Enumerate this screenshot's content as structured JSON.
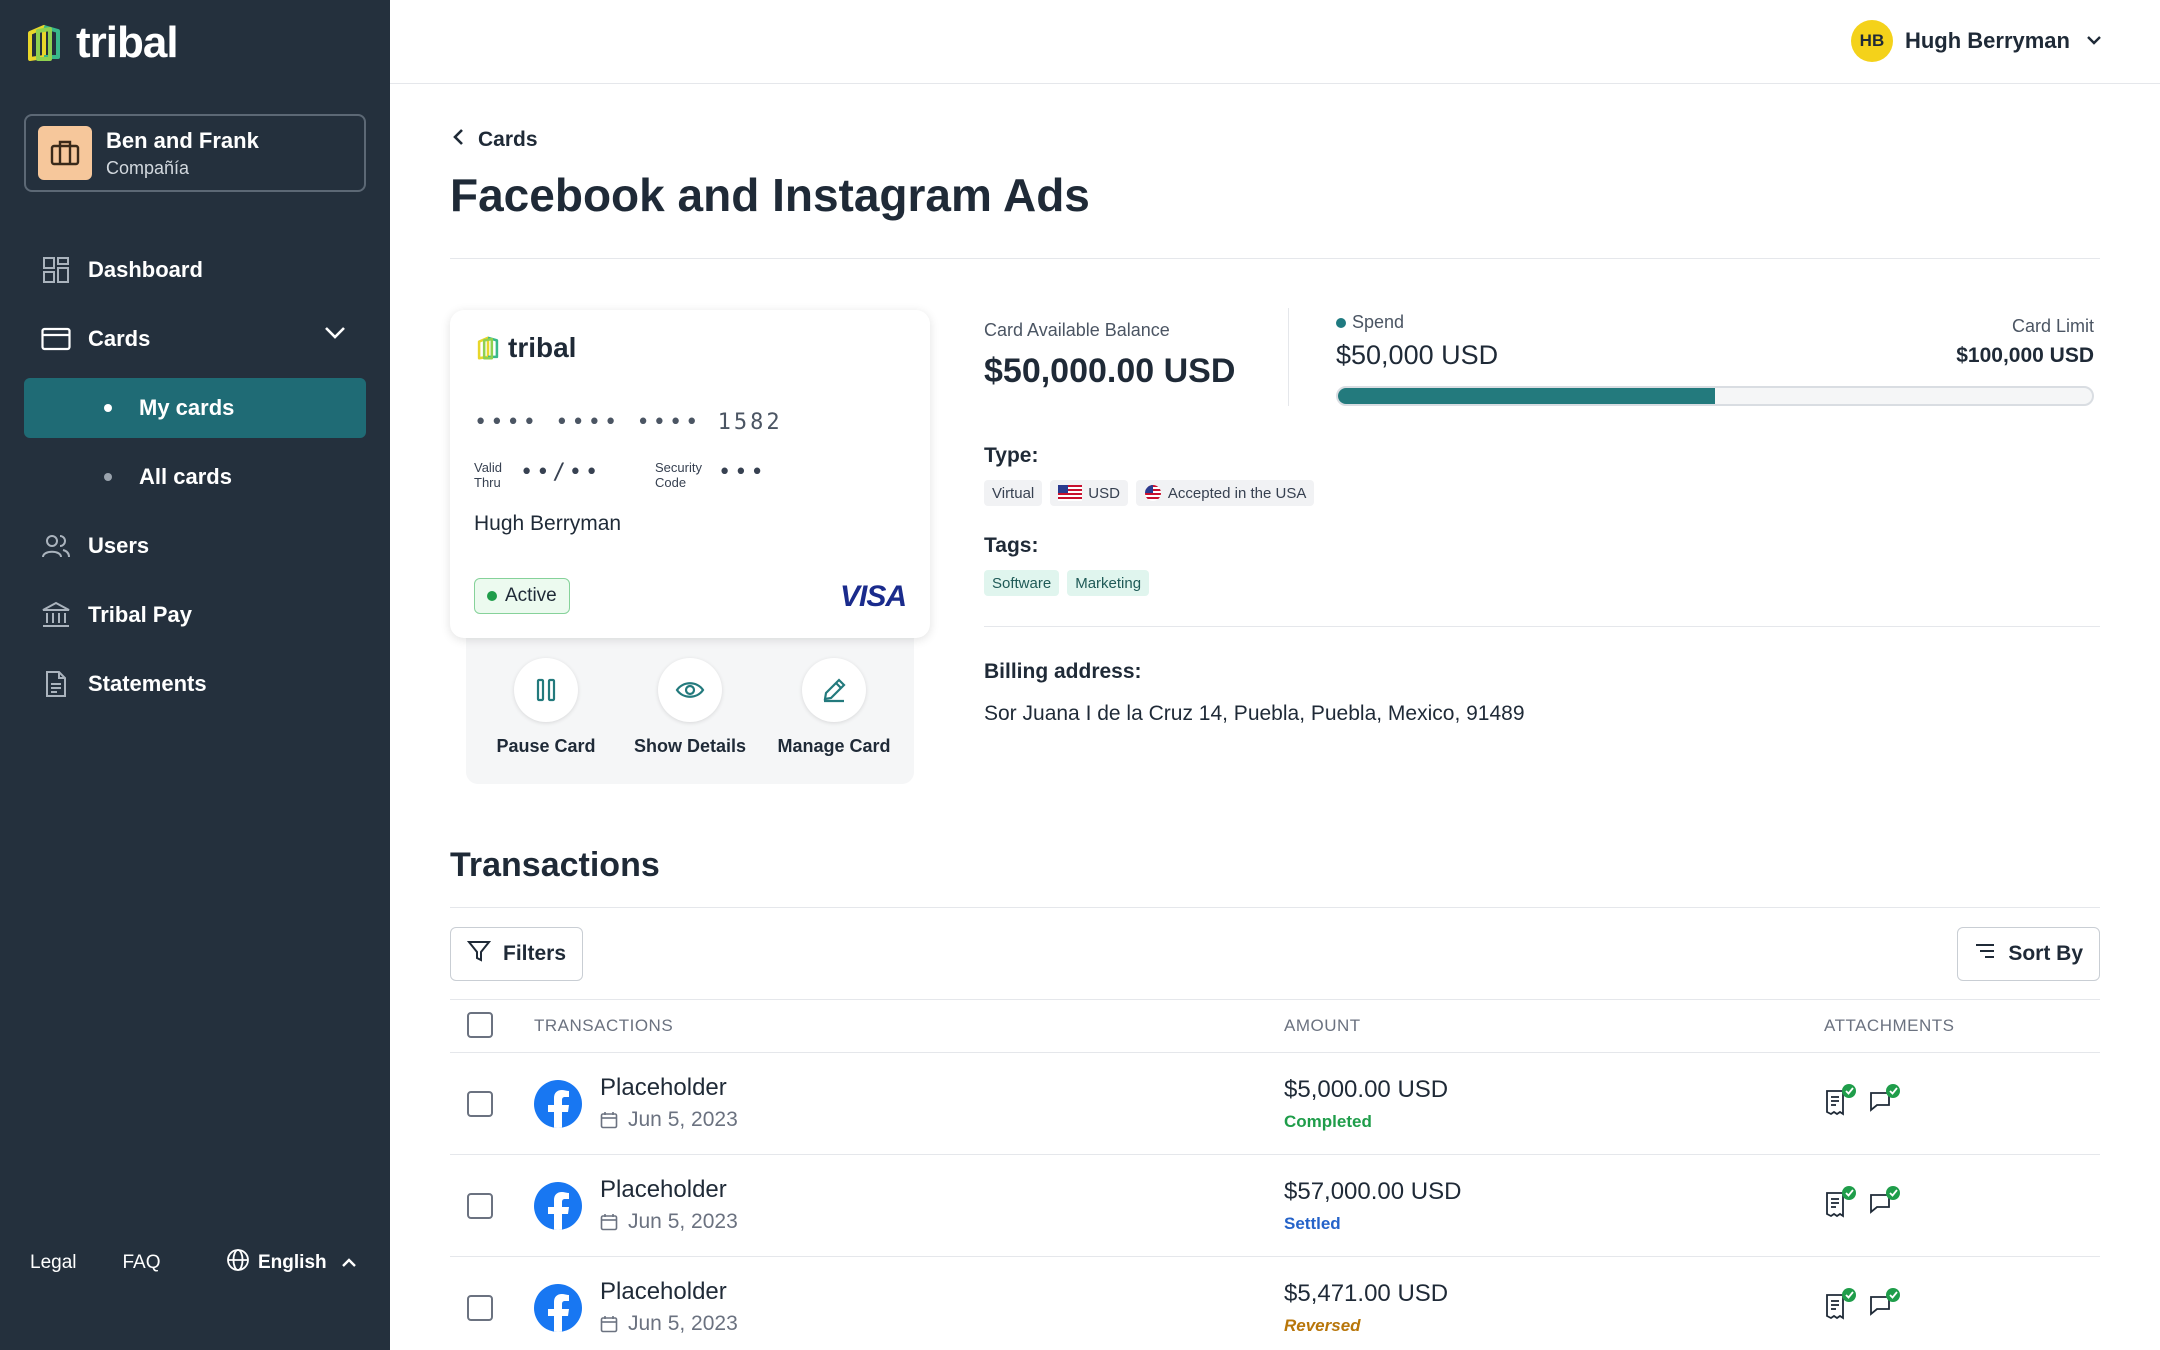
{
  "app": {
    "logo_text": "tribal"
  },
  "company": {
    "name": "Ben and Frank",
    "type": "Compañía"
  },
  "sidebar": {
    "items": [
      {
        "label": "Dashboard",
        "icon": "grid-icon"
      },
      {
        "label": "Cards",
        "icon": "card-icon",
        "expanded": true
      },
      {
        "label": "My cards",
        "active": true
      },
      {
        "label": "All cards",
        "active": false
      },
      {
        "label": "Users",
        "icon": "users-icon"
      },
      {
        "label": "Tribal Pay",
        "icon": "bank-icon"
      },
      {
        "label": "Statements",
        "icon": "document-icon"
      }
    ],
    "footer": {
      "legal": "Legal",
      "faq": "FAQ",
      "language": "English"
    }
  },
  "user": {
    "initials": "HB",
    "name": "Hugh Berryman",
    "avatar_color": "#f4d21a"
  },
  "breadcrumb": {
    "back_label": "Cards"
  },
  "page": {
    "title": "Facebook and Instagram Ads"
  },
  "card": {
    "brand": "tribal",
    "number_masked": "•••• •••• •••• 1582",
    "valid_thru_label_1": "Valid",
    "valid_thru_label_2": "Thru",
    "valid_thru_value": "••/••",
    "security_label_1": "Security",
    "security_label_2": "Code",
    "security_value": "•••",
    "holder": "Hugh Berryman",
    "status": "Active",
    "network": "VISA"
  },
  "card_actions": [
    {
      "label": "Pause Card",
      "icon": "pause-icon"
    },
    {
      "label": "Show Details",
      "icon": "eye-icon"
    },
    {
      "label": "Manage Card",
      "icon": "pencil-icon"
    }
  ],
  "balance": {
    "available_label": "Card Available Balance",
    "available_value": "$50,000.00 USD",
    "spend_label": "Spend",
    "spend_value": "$50,000 USD",
    "limit_label": "Card Limit",
    "limit_value": "$100,000 USD",
    "spend_fraction": 0.5,
    "accent_color": "#237a7d"
  },
  "type": {
    "label": "Type:",
    "chips": [
      "Virtual",
      "USD",
      "Accepted in the USA"
    ]
  },
  "tags": {
    "label": "Tags:",
    "chips": [
      "Software",
      "Marketing"
    ]
  },
  "billing": {
    "label": "Billing address:",
    "address": "Sor Juana I de la Cruz 14, Puebla, Puebla, Mexico, 91489"
  },
  "transactions": {
    "title": "Transactions",
    "filters_label": "Filters",
    "sort_label": "Sort By",
    "columns": [
      "TRANSACTIONS",
      "AMOUNT",
      "ATTACHMENTS"
    ],
    "rows": [
      {
        "name": "Placeholder",
        "date": "Jun 5, 2023",
        "amount": "$5,000.00 USD",
        "status": "Completed"
      },
      {
        "name": "Placeholder",
        "date": "Jun 5, 2023",
        "amount": "$57,000.00 USD",
        "status": "Settled"
      },
      {
        "name": "Placeholder",
        "date": "Jun 5, 2023",
        "amount": "$5,471.00 USD",
        "status": "Reversed"
      }
    ]
  }
}
